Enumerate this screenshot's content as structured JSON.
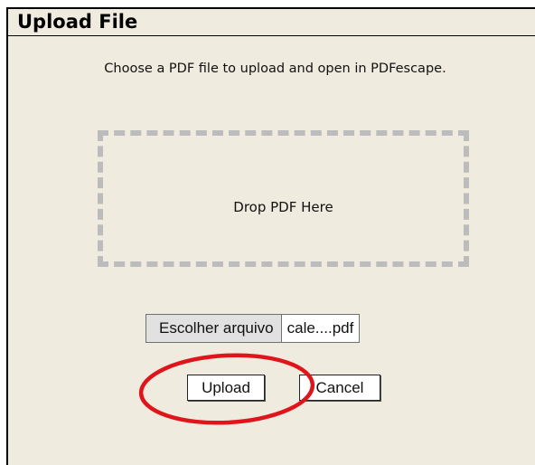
{
  "dialog": {
    "title": "Upload File",
    "instructions": "Choose a PDF file to upload and open in PDFescape.",
    "drop_zone_label": "Drop PDF Here",
    "file_input": {
      "button_label": "Escolher arquivo",
      "selected_file": "cale....pdf"
    },
    "buttons": {
      "upload_label": "Upload",
      "cancel_label": "Cancel"
    }
  },
  "colors": {
    "dialog_background": "#efebdf",
    "drop_zone_border": "#bcbcbc",
    "highlight_annotation": "#e0141b"
  }
}
